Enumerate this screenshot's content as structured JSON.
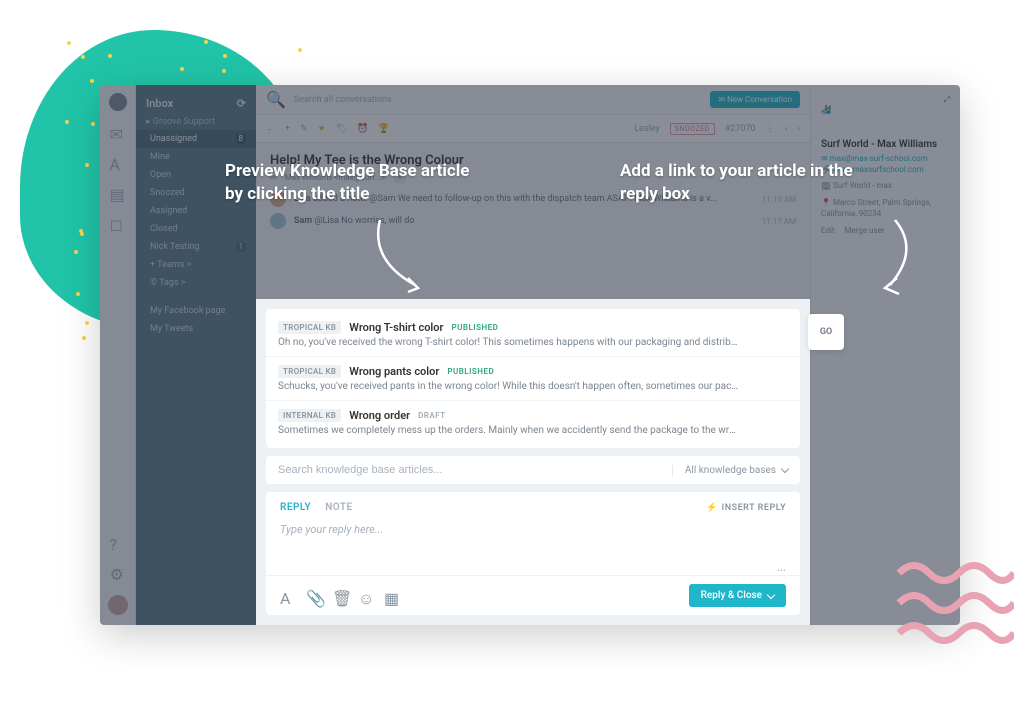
{
  "sidebar": {
    "title": "Inbox",
    "mailbox": "Groove Support",
    "items": [
      {
        "label": "Unassigned",
        "count": "8"
      },
      {
        "label": "Mine"
      },
      {
        "label": "Open"
      },
      {
        "label": "Snoozed"
      },
      {
        "label": "Assigned"
      },
      {
        "label": "Closed"
      },
      {
        "label": "Nick Testing",
        "count": "1"
      },
      {
        "label": "+ Teams >"
      },
      {
        "label": "© Tags >"
      }
    ],
    "extras": [
      "My Facebook page",
      "My Tweets"
    ]
  },
  "topbar": {
    "search_placeholder": "Search all conversations",
    "new_button": "New Conversation"
  },
  "toolbar": {
    "assignee": "Lesley",
    "status": "SNOOZED",
    "ticket_id": "#27070"
  },
  "conversation": {
    "title": "Help! My Tee is the Wrong Colour",
    "subtitle": "Max Williams <max@surf...>",
    "messages": [
      {
        "author": "Lisa",
        "text": "added a note: @Sam We need to follow-up on this with the dispatch team ASAP! Max Williams is a v...",
        "time": "11:15 AM"
      },
      {
        "author": "Sam",
        "text": "@Lisa No worries, will do",
        "time": "11:17 AM"
      }
    ]
  },
  "kb": {
    "results": [
      {
        "tag": "TROPICAL KB",
        "title": "Wrong T-shirt color",
        "status": "PUBLISHED",
        "status_class": "pub",
        "excerpt": "Oh no, you've received the wrong T-shirt color! This sometimes happens with our packaging and distribution center, but luckily we h..."
      },
      {
        "tag": "TROPICAL KB",
        "title": "Wrong pants color",
        "status": "PUBLISHED",
        "status_class": "pub",
        "excerpt": "Schucks, you've received pants in the wrong color! While this doesn't happen often, sometimes our packaging and distribution cent..."
      },
      {
        "tag": "INTERNAL KB",
        "title": "Wrong order",
        "status": "DRAFT",
        "status_class": "draft",
        "excerpt": "Sometimes we completely mess up the orders. Mainly when we accidently send the package to the wrong customers. Fixing this is ..."
      }
    ],
    "go": "GO",
    "search_placeholder": "Search knowledge base articles...",
    "filter": "All knowledge bases"
  },
  "reply": {
    "tab_reply": "REPLY",
    "tab_note": "NOTE",
    "insert": "INSERT REPLY",
    "placeholder": "Type your reply here...",
    "send": "Reply & Close"
  },
  "contact": {
    "name": "Surf World - Max Williams",
    "email": "max@max-surf-school.com",
    "website": "www.maxsurfschool.com",
    "company": "Surf World - max",
    "address": "Marco Street, Palm Springs, California, 90234",
    "edit": "Edit",
    "merge": "Merge user"
  },
  "callouts": {
    "left": "Preview Knowledge Base article by clicking the title",
    "right": "Add a link to your article in the reply box"
  }
}
